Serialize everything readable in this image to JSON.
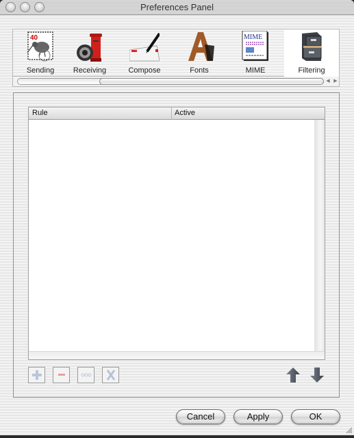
{
  "window": {
    "title": "Preferences Panel"
  },
  "toolbar": {
    "items": [
      {
        "label": "Sending",
        "icon": "kiwi-stamp-icon",
        "selected": false
      },
      {
        "label": "Receiving",
        "icon": "postbox-icon",
        "selected": false
      },
      {
        "label": "Compose",
        "icon": "pen-envelope-icon",
        "selected": false
      },
      {
        "label": "Fonts",
        "icon": "letter-a-icon",
        "selected": false
      },
      {
        "label": "MIME",
        "icon": "mime-document-icon",
        "mime_text": "MIME",
        "selected": false
      },
      {
        "label": "Filtering",
        "icon": "file-cabinet-icon",
        "selected": true
      }
    ],
    "stamp_text": "40"
  },
  "rules_table": {
    "columns": [
      "Rule",
      "Active"
    ],
    "rows": []
  },
  "rule_buttons": {
    "add": "+",
    "remove": "−",
    "edit": "◦◦◦",
    "clear": "X"
  },
  "footer": {
    "cancel_label": "Cancel",
    "apply_label": "Apply",
    "ok_label": "OK"
  }
}
